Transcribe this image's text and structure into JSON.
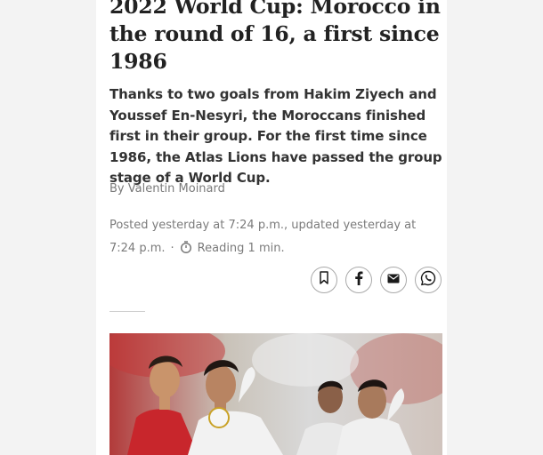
{
  "article": {
    "headline": "2022 World Cup: Morocco in the round of 16, a first since 1986",
    "standfirst": "Thanks to two goals from Hakim Ziyech and Youssef En-Nesyri, the Moroccans finished first in their group. For the first time since 1986, the Atlas Lions have passed the group stage of a World Cup.",
    "byline": "By Valentin Moinard",
    "posted": "Posted yesterday at 7:24 p.m., updated yesterday at 7:24 p.m.",
    "separator": "·",
    "reading_time": "Reading 1 min."
  },
  "share": {
    "icons": [
      "bookmark-icon",
      "facebook-icon",
      "mail-icon",
      "whatsapp-icon"
    ],
    "colors": {
      "border": "#a9a9a9",
      "icon": "#1a1a1a"
    }
  },
  "colors": {
    "page_bg": "#f3f3f3",
    "card_bg": "#ffffff",
    "headline": "#222222",
    "body": "#333333",
    "meta": "#7b7b7b",
    "jersey_red": "#c8262c",
    "jersey_white": "#f2f2f2"
  }
}
